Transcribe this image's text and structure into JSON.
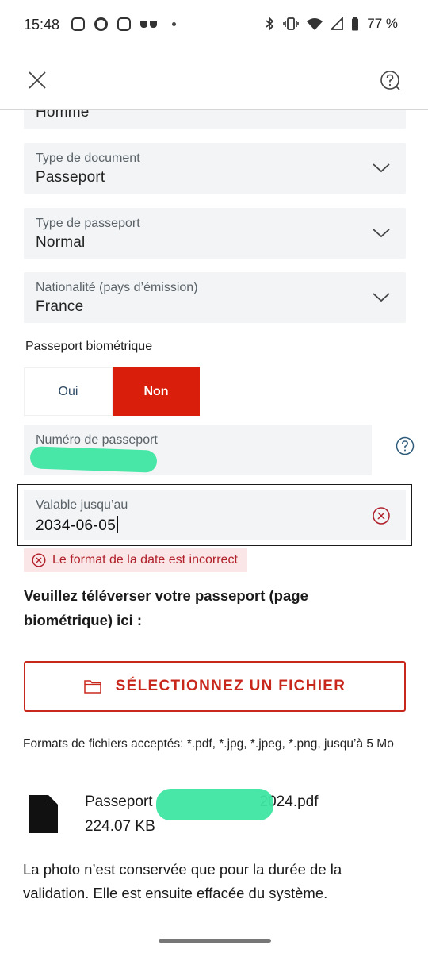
{
  "status_bar": {
    "time": "15:48",
    "battery": "77 %",
    "icons_left": [
      "instagram-icon",
      "c-app-icon",
      "instagram-icon",
      "glasses-icon",
      "dot-icon"
    ],
    "icons_right": [
      "bluetooth-icon",
      "vibrate-icon",
      "wifi-icon",
      "signal-icon",
      "battery-icon"
    ]
  },
  "header": {
    "close_icon": "close-icon",
    "help_icon": "help-icon"
  },
  "form": {
    "gender": {
      "value": "Homme"
    },
    "document_type": {
      "label": "Type de document",
      "value": "Passeport"
    },
    "passport_type": {
      "label": "Type de passeport",
      "value": "Normal"
    },
    "nationality": {
      "label": "Nationalité (pays d’émission)",
      "value": "France"
    },
    "biometric": {
      "label": "Passeport biométrique",
      "options": [
        "Oui",
        "Non"
      ],
      "selected": "Non"
    },
    "passport_number": {
      "label": "Numéro de passeport"
    },
    "expiry": {
      "label": "Valable jusqu’au",
      "value": "2034-06-05"
    },
    "error": "Le format de la date est incorrect"
  },
  "upload": {
    "title": "Veuillez téléverser votre passeport (page biométrique) ici :",
    "button_label": "SÉLECTIONNEZ UN FICHIER",
    "formats": "Formats de fichiers acceptés: *.pdf, *.jpg, *.jpeg, *.png, jusqu’à 5 Mo",
    "file": {
      "name_start": "Passeport",
      "name_end": "2024.pdf",
      "size": "224.07 KB"
    },
    "note": "La photo n’est conservée que pour la durée de la validation. Elle est ensuite effacée du système."
  },
  "colors": {
    "accent_red": "#d91f0b",
    "outline_red": "#c8281c",
    "field_bg": "#f2f4f5",
    "error_bg": "#fbe6e7",
    "error_text": "#b0202a",
    "redaction": "#3ee6a3"
  }
}
